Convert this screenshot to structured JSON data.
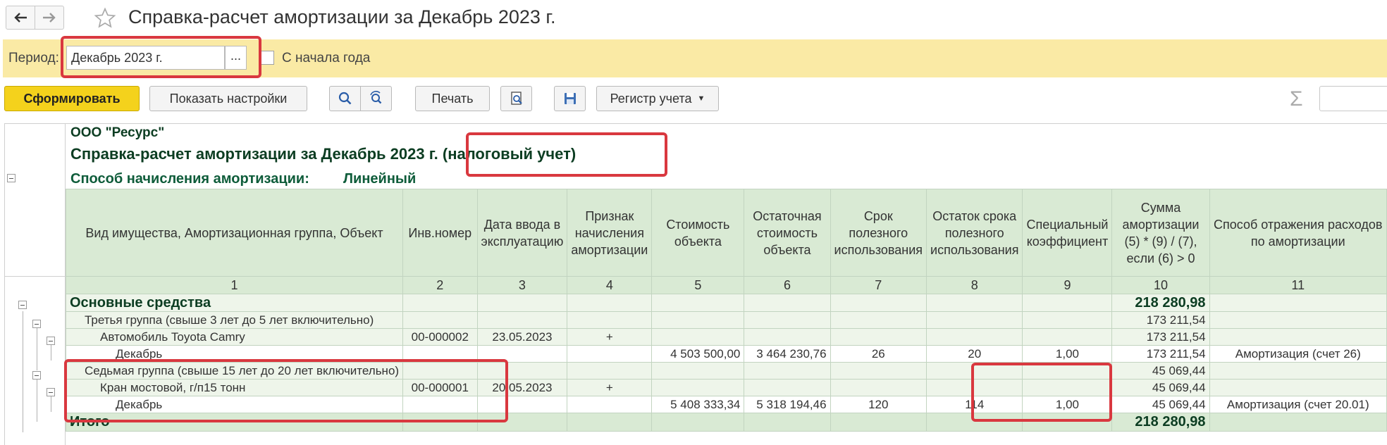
{
  "window": {
    "title": "Справка-расчет амортизации за Декабрь 2023 г."
  },
  "period": {
    "label": "Период:",
    "value": "Декабрь 2023 г.",
    "select_label": "...",
    "from_year_start_label": "С начала года"
  },
  "toolbar": {
    "generate": "Сформировать",
    "show_settings": "Показать настройки",
    "print": "Печать",
    "register": "Регистр учета",
    "sum_symbol": "Σ"
  },
  "report": {
    "org": "ООО \"Ресурс\"",
    "title": "Справка-расчет амортизации за Декабрь 2023 г. (налоговый учет)",
    "method_label": "Способ начисления амортизации:",
    "method_value": "Линейный",
    "headers": [
      "Вид имущества, Амортизационная группа, Объект",
      "Инв.номер",
      "Дата ввода в эксплуатацию",
      "Признак начисления амортизации",
      "Стоимость объекта",
      "Остаточная стоимость объекта",
      "Срок полезного использования",
      "Остаток срока полезного использования",
      "Специальный коэффициент",
      "Сумма амортизации (5) * (9) / (7), если (6) > 0",
      "Способ отражения расходов по амортизации"
    ],
    "col_numbers": [
      "1",
      "2",
      "3",
      "4",
      "5",
      "6",
      "7",
      "8",
      "9",
      "10",
      "11"
    ],
    "rows": [
      {
        "name": "Основные средства",
        "inv": "",
        "date": "",
        "flag": "",
        "cost": "",
        "residual": "",
        "term": "",
        "remain": "",
        "coef": "",
        "sum": "218 280,98",
        "method": ""
      },
      {
        "name": "Третья группа (свыше 3 лет до 5 лет включительно)",
        "inv": "",
        "date": "",
        "flag": "",
        "cost": "",
        "residual": "",
        "term": "",
        "remain": "",
        "coef": "",
        "sum": "173 211,54",
        "method": ""
      },
      {
        "name": "Автомобиль Toyota Camry",
        "inv": "00-000002",
        "date": "23.05.2023",
        "flag": "+",
        "cost": "",
        "residual": "",
        "term": "",
        "remain": "",
        "coef": "",
        "sum": "173 211,54",
        "method": ""
      },
      {
        "name": "Декабрь",
        "inv": "",
        "date": "",
        "flag": "",
        "cost": "4 503 500,00",
        "residual": "3 464 230,76",
        "term": "26",
        "remain": "20",
        "coef": "1,00",
        "sum": "173 211,54",
        "method": "Амортизация (счет 26)"
      },
      {
        "name": "Седьмая группа (свыше 15 лет до 20 лет включительно)",
        "inv": "",
        "date": "",
        "flag": "",
        "cost": "",
        "residual": "",
        "term": "",
        "remain": "",
        "coef": "",
        "sum": "45 069,44",
        "method": ""
      },
      {
        "name": "Кран мостовой, г/п15 тонн",
        "inv": "00-000001",
        "date": "20.05.2023",
        "flag": "+",
        "cost": "",
        "residual": "",
        "term": "",
        "remain": "",
        "coef": "",
        "sum": "45 069,44",
        "method": ""
      },
      {
        "name": "Декабрь",
        "inv": "",
        "date": "",
        "flag": "",
        "cost": "5 408 333,34",
        "residual": "5 318 194,46",
        "term": "120",
        "remain": "114",
        "coef": "1,00",
        "sum": "45 069,44",
        "method": "Амортизация (счет 20.01)"
      }
    ],
    "total": {
      "label": "Итого",
      "sum": "218 280,98"
    }
  }
}
